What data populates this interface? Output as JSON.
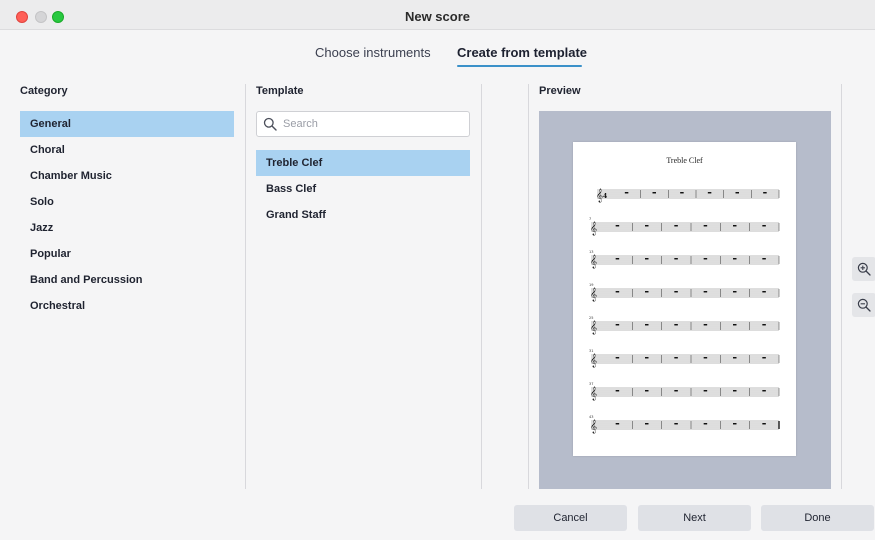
{
  "window": {
    "title": "New score"
  },
  "tabs": [
    {
      "label": "Choose instruments",
      "active": false
    },
    {
      "label": "Create from template",
      "active": true
    }
  ],
  "category": {
    "heading": "Category",
    "selected": "General",
    "items": [
      "General",
      "Choral",
      "Chamber Music",
      "Solo",
      "Jazz",
      "Popular",
      "Band and Percussion",
      "Orchestral"
    ]
  },
  "template": {
    "heading": "Template",
    "search_placeholder": "Search",
    "selected": "Treble Clef",
    "items": [
      "Treble Clef",
      "Bass Clef",
      "Grand Staff"
    ]
  },
  "preview": {
    "heading": "Preview",
    "score_title": "Treble Clef",
    "system_count": 8,
    "measure_numbers": [
      "",
      "7",
      "13",
      "19",
      "25",
      "31",
      "37",
      "43"
    ]
  },
  "zoom": {
    "in_icon": "zoom-in-icon",
    "out_icon": "zoom-out-icon"
  },
  "buttons": {
    "cancel": "Cancel",
    "next": "Next",
    "done": "Done"
  },
  "colors": {
    "selected_row": "#a9d2f1",
    "accent_underline": "#3b91c9",
    "preview_bg": "#b6bccb"
  }
}
